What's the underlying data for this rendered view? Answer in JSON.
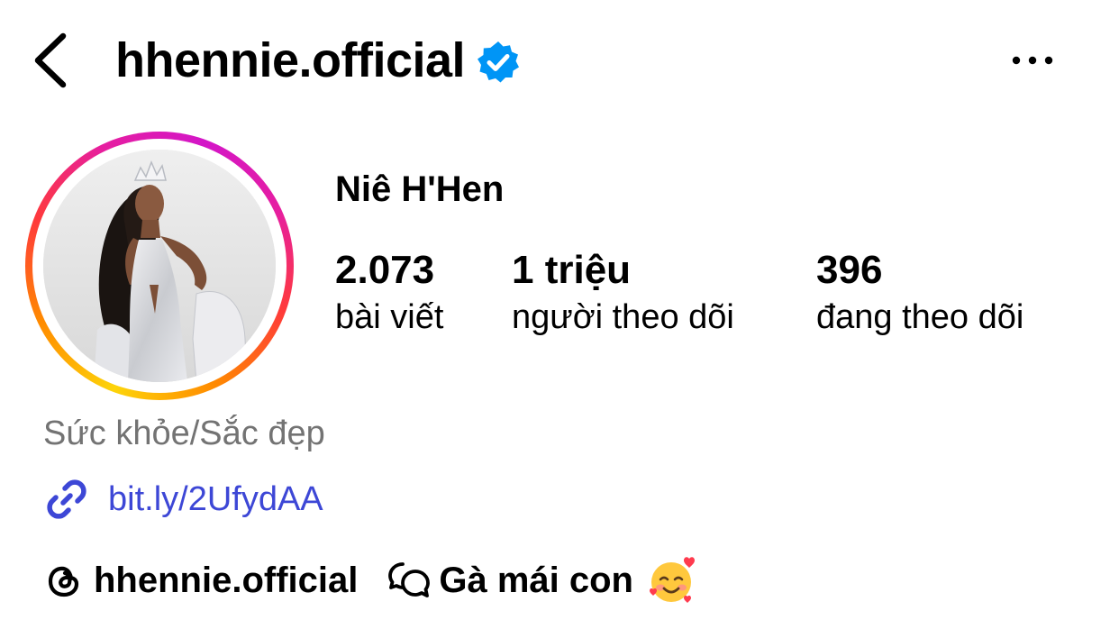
{
  "header": {
    "username": "hhennie.official",
    "verified": true,
    "back_icon": "chevron-left-icon",
    "more_icon": "more-horizontal-icon",
    "verified_color": "#0095f6"
  },
  "profile": {
    "full_name": "Niê H'Hen",
    "avatar": "profile-photo",
    "story_ring_colors": [
      "#fdd40a",
      "#ff8a00",
      "#ff3a3a",
      "#e61ea0",
      "#d316c8"
    ]
  },
  "stats": {
    "posts": {
      "value": "2.073",
      "label": "bài viết"
    },
    "followers": {
      "value": "1 triệu",
      "label": "người theo dõi"
    },
    "following": {
      "value": "396",
      "label": "đang theo dõi"
    }
  },
  "bio": {
    "category": "Sức khỏe/Sắc đẹp",
    "link": "bit.ly/2UfydAA",
    "link_color": "#3d47d6"
  },
  "threads": {
    "handle": "hhennie.official",
    "note": "Gà mái con",
    "note_emoji": "smiling-face-with-hearts"
  }
}
